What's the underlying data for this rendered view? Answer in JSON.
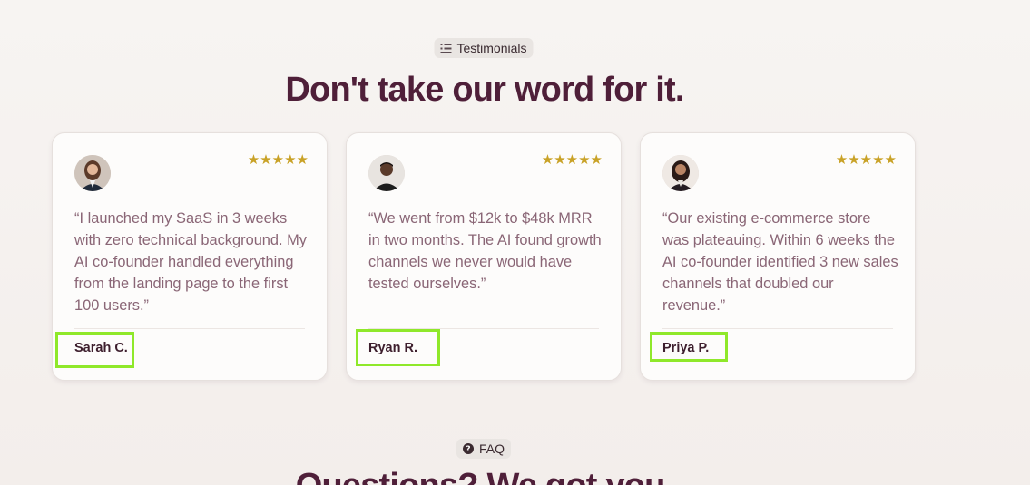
{
  "section_badge": {
    "label": "Testimonials",
    "icon": "list-icon"
  },
  "headline": "Don't take our word for it.",
  "testimonials": [
    {
      "name": "Sarah C.",
      "rating": 5,
      "stars": "★★★★★",
      "quote": "“I launched my SaaS in 3 weeks with zero technical background. My AI co-founder handled everything from the landing page to the first 100 users.”"
    },
    {
      "name": "Ryan R.",
      "rating": 5,
      "stars": "★★★★★",
      "quote": "“We went from $12k to $48k MRR in two months. The AI found growth channels we never would have tested ourselves.”"
    },
    {
      "name": "Priya P.",
      "rating": 5,
      "stars": "★★★★★",
      "quote": "“Our existing e-commerce store was plateauing. Within 6 weeks the AI co-founder identified 3 new sales channels that doubled our revenue.”"
    }
  ],
  "faq_badge": {
    "label": "FAQ",
    "icon": "question-circle-icon"
  },
  "faq_headline": "Questions? We got you.",
  "colors": {
    "headline": "#4f1f39",
    "star": "#c9a227",
    "quote_text": "#8a6676",
    "highlight": "#8fe82a"
  }
}
